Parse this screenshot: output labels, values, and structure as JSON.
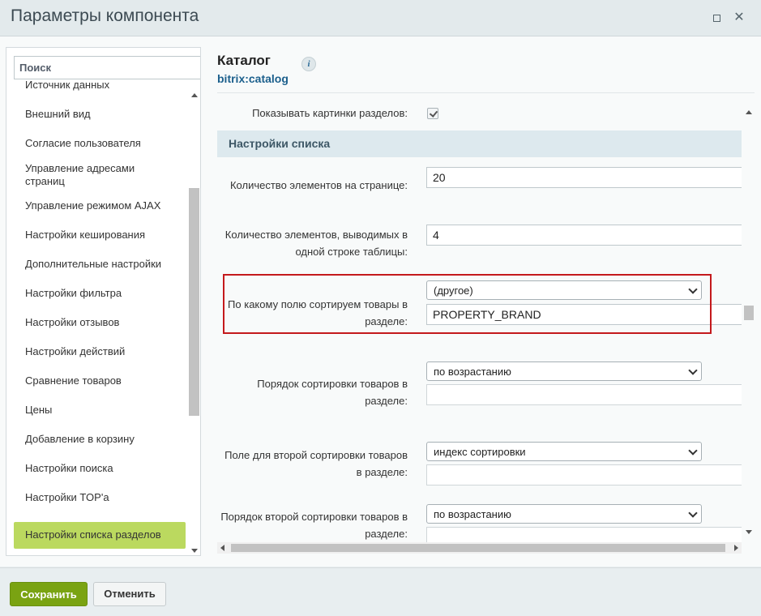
{
  "window": {
    "title": "Параметры компонента"
  },
  "search": {
    "placeholder": "Поиск"
  },
  "sidebar": {
    "items": [
      {
        "label": "Источник данных"
      },
      {
        "label": "Внешний вид"
      },
      {
        "label": "Согласие пользователя"
      },
      {
        "label": "Управление адресами страниц"
      },
      {
        "label": "Управление режимом AJAX"
      },
      {
        "label": "Настройки кеширования"
      },
      {
        "label": "Дополнительные настройки"
      },
      {
        "label": "Настройки фильтра"
      },
      {
        "label": "Настройки отзывов"
      },
      {
        "label": "Настройки действий"
      },
      {
        "label": "Сравнение товаров"
      },
      {
        "label": "Цены"
      },
      {
        "label": "Добавление в корзину"
      },
      {
        "label": "Настройки поиска"
      },
      {
        "label": "Настройки TOP'а"
      },
      {
        "label": "Настройки списка разделов",
        "active": true
      }
    ]
  },
  "component": {
    "name": "Каталог",
    "code": "bitrix:catalog",
    "info_icon": "info-icon"
  },
  "form": {
    "show_section_pictures": {
      "label": "Показывать картинки разделов:",
      "checked": true
    },
    "section_title": "Настройки списка",
    "page_element_count": {
      "label": "Количество элементов на странице:",
      "value": "20"
    },
    "line_element_count": {
      "label_line1": "Количество элементов, выводимых в",
      "label_line2": "одной строке таблицы:",
      "value": "4"
    },
    "sort_field": {
      "label_line1": "По какому полю сортируем товары в",
      "label_line2": "разделе:",
      "selected": "(другое)",
      "custom_value": "PROPERTY_BRAND"
    },
    "sort_order": {
      "label_line1": "Порядок сортировки товаров в",
      "label_line2": "разделе:",
      "selected": "по возрастанию"
    },
    "sort_field2": {
      "label_line1": "Поле для второй сортировки товаров",
      "label_line2": "в разделе:",
      "selected": "индекс сортировки"
    },
    "sort_order2": {
      "label_line1": "Порядок второй сортировки товаров в",
      "label_line2": "разделе:",
      "selected": "по возрастанию"
    }
  },
  "footer": {
    "save_label": "Сохранить",
    "cancel_label": "Отменить"
  },
  "colors": {
    "save_button": "#7aa312",
    "active_item": "#bbd95f",
    "highlight_box": "#c4191c"
  }
}
